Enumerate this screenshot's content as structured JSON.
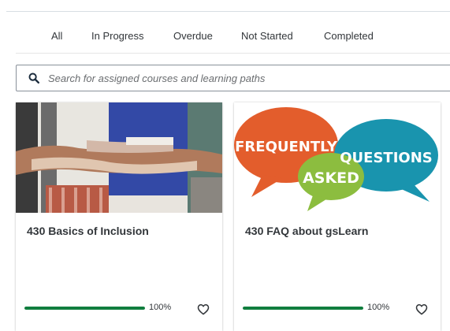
{
  "tabs": [
    {
      "label": "All"
    },
    {
      "label": "In Progress"
    },
    {
      "label": "Overdue"
    },
    {
      "label": "Not Started"
    },
    {
      "label": "Completed"
    }
  ],
  "search": {
    "placeholder": "Search for assigned courses and learning paths",
    "icon": "search-icon"
  },
  "courses": [
    {
      "title": "430 Basics of Inclusion",
      "progress": 1.0,
      "progress_label": "100%",
      "favorite_icon": "heart-outline-icon"
    },
    {
      "title": "430 FAQ about gsLearn",
      "progress": 1.0,
      "progress_label": "100%",
      "favorite_icon": "heart-outline-icon",
      "thumbnail_text": {
        "bubble1": "FREQUENTLY",
        "bubble2": "ASKED",
        "bubble3": "QUESTIONS"
      }
    }
  ],
  "colors": {
    "progress": "#107e3e",
    "bubble_orange": "#e35d2c",
    "bubble_green": "#8cbd3f",
    "bubble_teal": "#1994ae"
  }
}
